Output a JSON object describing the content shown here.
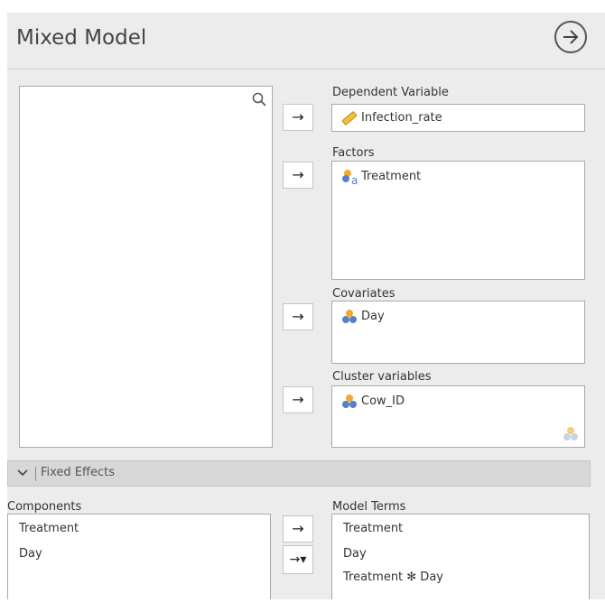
{
  "header": {
    "title": "Mixed Model",
    "run_icon": "arrow-right-circle-icon"
  },
  "variables_search_icon": "search-icon",
  "dependent": {
    "label": "Dependent Variable",
    "value": "Infection_rate",
    "icon": "ruler-icon"
  },
  "factors": {
    "label": "Factors",
    "items": [
      "Treatment"
    ],
    "icon": "nominal-variable-icon"
  },
  "covariates": {
    "label": "Covariates",
    "items": [
      "Day"
    ],
    "icon": "variable-icon"
  },
  "cluster": {
    "label": "Cluster variables",
    "items": [
      "Cow_ID"
    ],
    "icon": "variable-icon"
  },
  "move_button": {
    "label": "→",
    "dropdown_label": "→▾"
  },
  "fixed_effects": {
    "section_title": "Fixed Effects",
    "components_label": "Components",
    "components": [
      "Treatment",
      "Day"
    ],
    "model_terms_label": "Model Terms",
    "model_terms": [
      "Treatment",
      "Day",
      "Treatment ✻ Day"
    ]
  },
  "colors": {
    "panel": "#ececec",
    "section_header": "#d7d7d7",
    "accent_orange": "#f0a830",
    "accent_blue": "#5b7fc2"
  }
}
